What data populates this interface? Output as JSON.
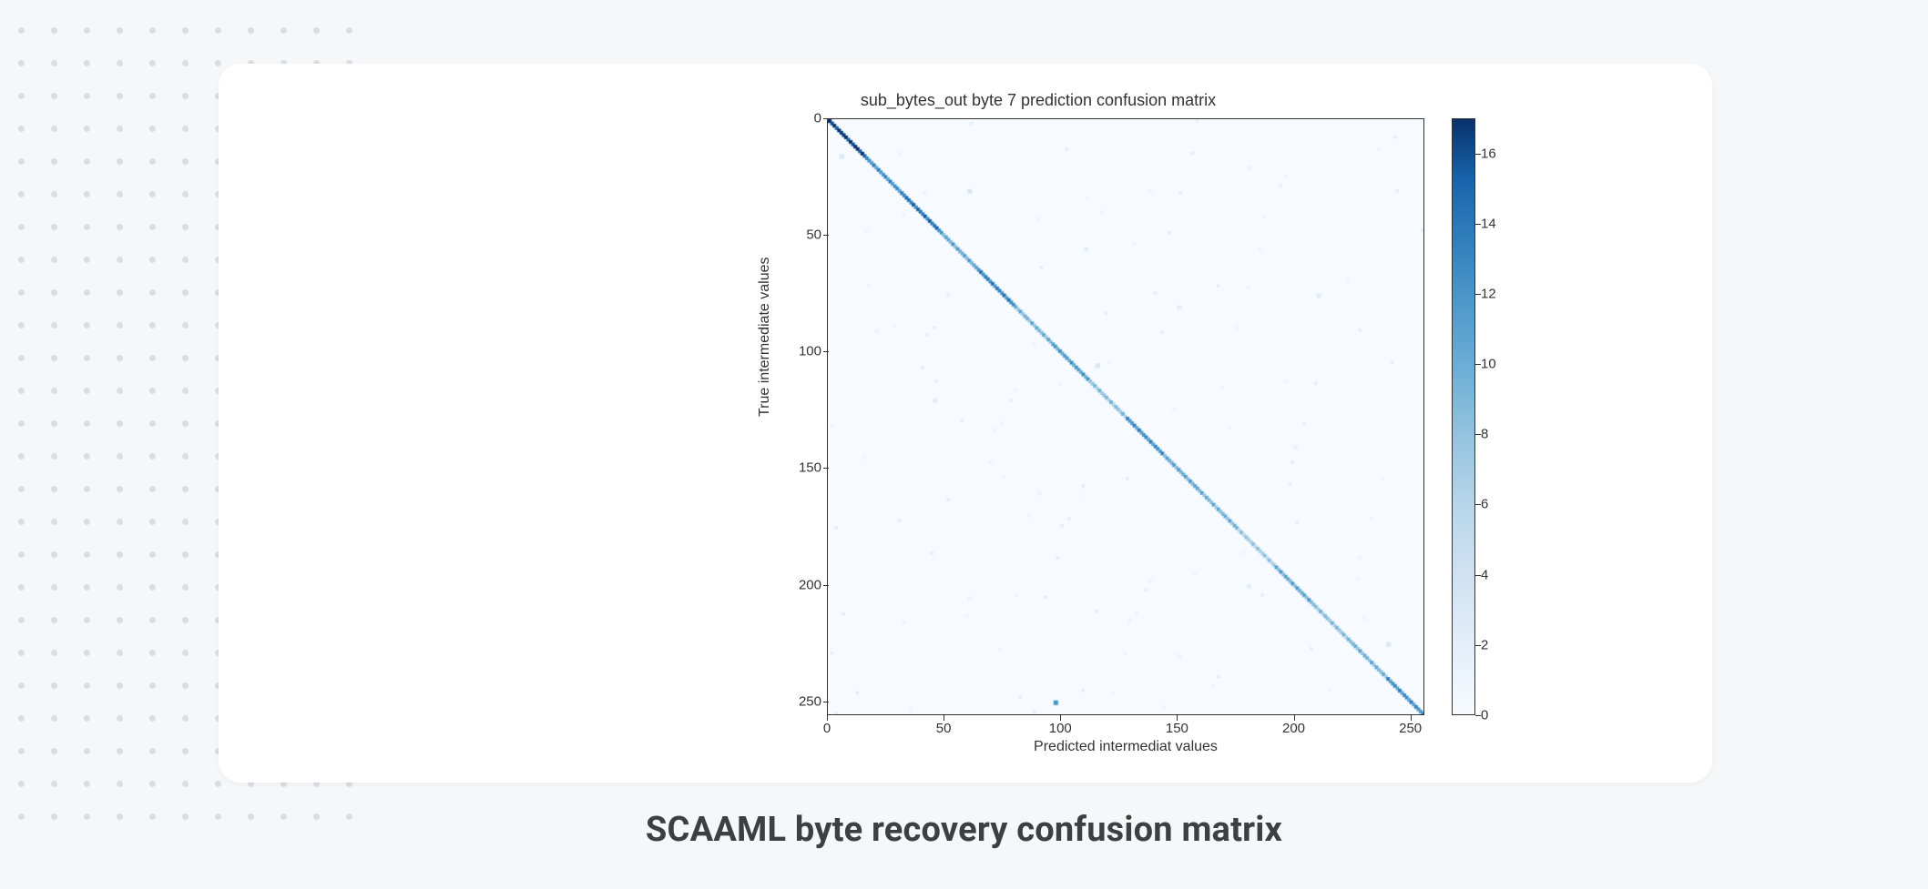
{
  "figure": {
    "caption": "SCAAML byte recovery confusion matrix"
  },
  "chart_data": {
    "type": "heatmap",
    "title": "sub_bytes_out byte 7 prediction confusion matrix",
    "xlabel": "Predicted intermediat values",
    "ylabel": "True intermediate values",
    "x_range": [
      0,
      256
    ],
    "y_range": [
      0,
      256
    ],
    "x_ticks": [
      0,
      50,
      100,
      150,
      200,
      250
    ],
    "y_ticks": [
      0,
      50,
      100,
      150,
      200,
      250
    ],
    "colorbar": {
      "min": 0,
      "max": 17,
      "ticks": [
        0,
        2,
        4,
        6,
        8,
        10,
        12,
        14,
        16
      ]
    },
    "description": "256x256 confusion matrix. Strong diagonal (true≈predicted) with values roughly 6–17; sparse faint off-diagonal noise values 1–3. Notable off-diagonal outlier near true≈250, predicted≈97 with value≈12.",
    "diagonal_sample_values": [
      17,
      12,
      14,
      10,
      13,
      9,
      11,
      8,
      12,
      10,
      9,
      7,
      10,
      8,
      9,
      12
    ],
    "off_diagonal_points": [
      {
        "true": 250,
        "predicted": 97,
        "value": 12
      },
      {
        "true": 30,
        "predicted": 60,
        "value": 3
      },
      {
        "true": 55,
        "predicted": 110,
        "value": 2
      },
      {
        "true": 80,
        "predicted": 150,
        "value": 2
      },
      {
        "true": 120,
        "predicted": 45,
        "value": 2
      },
      {
        "true": 160,
        "predicted": 90,
        "value": 1
      },
      {
        "true": 200,
        "predicted": 180,
        "value": 2
      },
      {
        "true": 225,
        "predicted": 240,
        "value": 3
      },
      {
        "true": 20,
        "predicted": 180,
        "value": 1
      },
      {
        "true": 75,
        "predicted": 210,
        "value": 2
      },
      {
        "true": 140,
        "predicted": 200,
        "value": 1
      },
      {
        "true": 15,
        "predicted": 5,
        "value": 3
      },
      {
        "true": 105,
        "predicted": 115,
        "value": 3
      },
      {
        "true": 205,
        "predicted": 60,
        "value": 1
      },
      {
        "true": 90,
        "predicted": 20,
        "value": 1
      },
      {
        "true": 230,
        "predicted": 150,
        "value": 1
      }
    ]
  }
}
